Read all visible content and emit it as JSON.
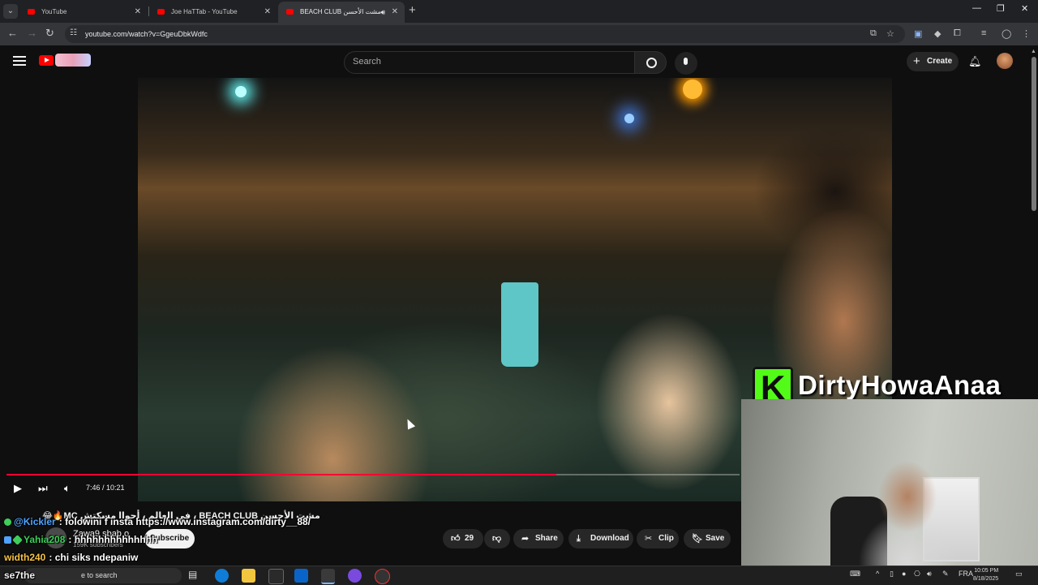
{
  "browser": {
    "tabs": [
      {
        "title": "YouTube",
        "active": false
      },
      {
        "title": "Joe HaTTab - YouTube",
        "active": false
      },
      {
        "title": "BEACH CLUB مشت الأحسن",
        "active": true
      }
    ],
    "url": "youtube.com/watch?v=GgeuDbkWdfc"
  },
  "yt": {
    "search_placeholder": "Search",
    "create_label": "Create"
  },
  "player": {
    "time": "7:46 / 10:21",
    "progress": 0.75
  },
  "video_info": {
    "title": "😂🔥MC فى العالم ، أحواا مسكتش ، BEACH CLUB مشت الأحسن",
    "channel_name": "Zawa9 sbab o",
    "subscribers": "159K subscribers",
    "subscribe_label": "Subscribe",
    "likes": "29",
    "share_label": "Share",
    "download_label": "Download",
    "clip_label": "Clip",
    "save_label": "Save"
  },
  "chat": [
    {
      "user": "@Kickler",
      "message": ": folowini f insta https://www.instagram.com/dirty__88/",
      "color": "#4fa3ff"
    },
    {
      "user": "Yahia208",
      "message": ": hhhhhhhhhhhhhh",
      "color": "#3ecf5a"
    },
    {
      "user": "width240",
      "message": ": chi siks ndepaniw",
      "color": "#f6c343"
    },
    {
      "user": "se7the",
      "message": "",
      "color": "#f1f1f1"
    }
  ],
  "stream_overlay": {
    "brand_name": "DirtyHowaAnaa"
  },
  "taskbar": {
    "search_label": "e to search",
    "lang": "FRA",
    "time": "10:05 PM",
    "date": "8/18/2025"
  },
  "icons": {
    "back": "arrow-left-icon",
    "forward": "arrow-right-icon",
    "reload": "reload-icon",
    "menu": "hamburger-icon",
    "search": "search-icon",
    "mic": "mic-icon",
    "bell": "bell-icon"
  },
  "colors": {
    "yt_red": "#ff0000",
    "progress_red": "#ff0033",
    "kick_green": "#53fc18"
  }
}
